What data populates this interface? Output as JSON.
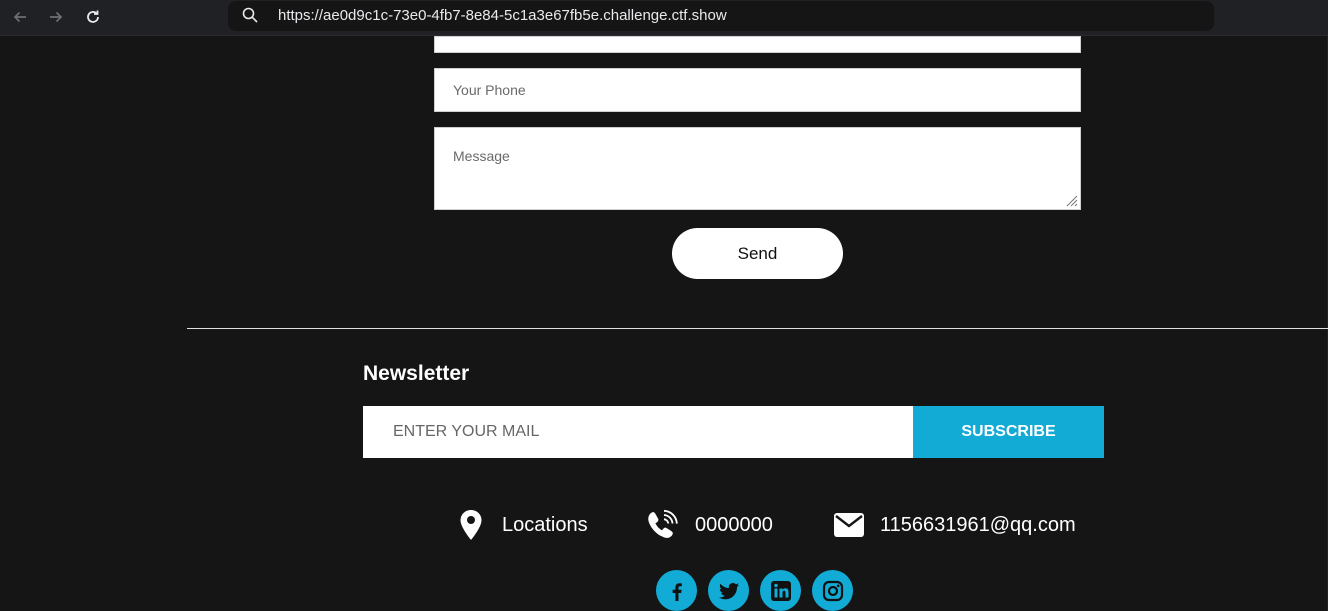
{
  "browser": {
    "url": "https://ae0d9c1c-73e0-4fb7-8e84-5c1a3e67fb5e.challenge.ctf.show"
  },
  "form": {
    "phone_placeholder": "Your Phone",
    "message_placeholder": "Message",
    "send_label": "Send"
  },
  "newsletter": {
    "title": "Newsletter",
    "mail_placeholder": "ENTER YOUR MAIL",
    "subscribe_label": "SUBSCRIBE"
  },
  "contact": {
    "location": "Locations",
    "phone": "0000000",
    "email": "1156631961@qq.com"
  },
  "social": {
    "icons": [
      "facebook-icon",
      "twitter-icon",
      "linkedin-icon",
      "instagram-icon"
    ]
  },
  "colors": {
    "background": "#151515",
    "accent": "#12abd6",
    "white": "#ffffff"
  }
}
